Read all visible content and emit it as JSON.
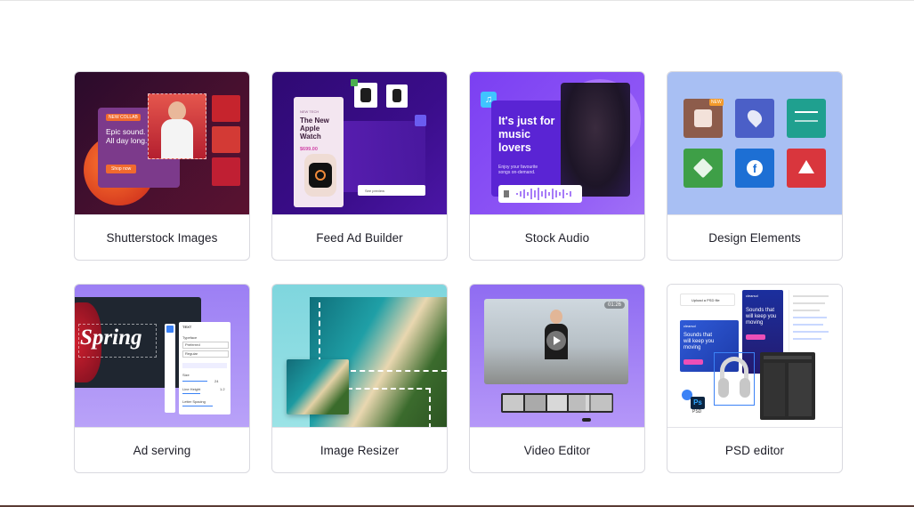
{
  "cards": [
    {
      "label": "Shutterstock Images",
      "thumb": {
        "badge": "NEW COLLAB",
        "headline": "Epic sound. All day long.",
        "button": "Shop now"
      }
    },
    {
      "label": "Feed Ad Builder",
      "thumb": {
        "eyebrow": "NEW TECH",
        "headline": "The New Apple Watch",
        "price": "$699.00",
        "toolbar_text": "See preview"
      }
    },
    {
      "label": "Stock Audio",
      "thumb": {
        "headline": "It's just for music lovers",
        "sub": "Enjoy your favourite songs on-demand."
      }
    },
    {
      "label": "Design Elements",
      "thumb": {
        "badge": "NEW"
      }
    },
    {
      "label": "Ad serving",
      "thumb": {
        "headline": "Spring",
        "panel_title": "TEXT",
        "font_label": "Typeface",
        "font_value": "Preferred",
        "weight_value": "Regular",
        "size_label": "Size",
        "size_value": "24",
        "line_label": "Line Height",
        "line_value": "1.2",
        "spacing_label": "Letter Spacing"
      }
    },
    {
      "label": "Image Resizer",
      "thumb": {}
    },
    {
      "label": "Video Editor",
      "thumb": {
        "time": "01:26"
      }
    },
    {
      "label": "PSD editor",
      "thumb": {
        "file_label": "Upload a PSD file",
        "ad_text_1": "Sounds that will keep you moving",
        "ad_text_2": "Sounds that will keep you moving",
        "brand": "clearsol",
        "ps": "Ps",
        "psd": "PSD"
      }
    }
  ],
  "colors": {
    "card_border": "#d9d9df",
    "label_text": "#1e1e28",
    "accent_purple": "#8b5cf6"
  }
}
